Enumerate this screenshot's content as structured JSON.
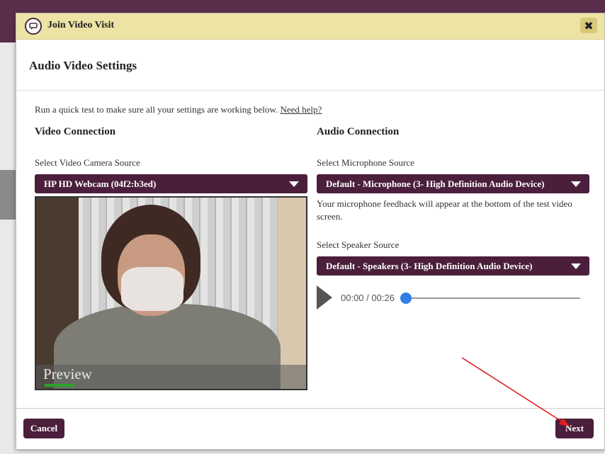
{
  "dialog": {
    "title": "Join Video Visit",
    "close_icon": "close-x-icon",
    "heading": "Audio Video Settings",
    "intro_text": "Run a quick test to make sure all your settings are working below.",
    "help_link": "Need help?"
  },
  "video": {
    "section_title": "Video Connection",
    "camera_label": "Select Video Camera Source",
    "camera_value": "HP HD Webcam (04f2:b3ed)",
    "preview_label": "Preview"
  },
  "audio": {
    "section_title": "Audio Connection",
    "mic_label": "Select Microphone Source",
    "mic_value": "Default - Microphone (3- High Definition Audio Device)",
    "mic_note": "Your microphone feedback will appear at the bottom of the test video screen.",
    "speaker_label": "Select Speaker Source",
    "speaker_value": "Default - Speakers (3- High Definition Audio Device)",
    "player_time": "00:00 / 00:26",
    "player_progress": 0
  },
  "footer": {
    "cancel_label": "Cancel",
    "next_label": "Next"
  },
  "colors": {
    "brand": "#4b1f3b",
    "titlebar": "#ece3a4",
    "slider_thumb": "#2f7ee6"
  }
}
